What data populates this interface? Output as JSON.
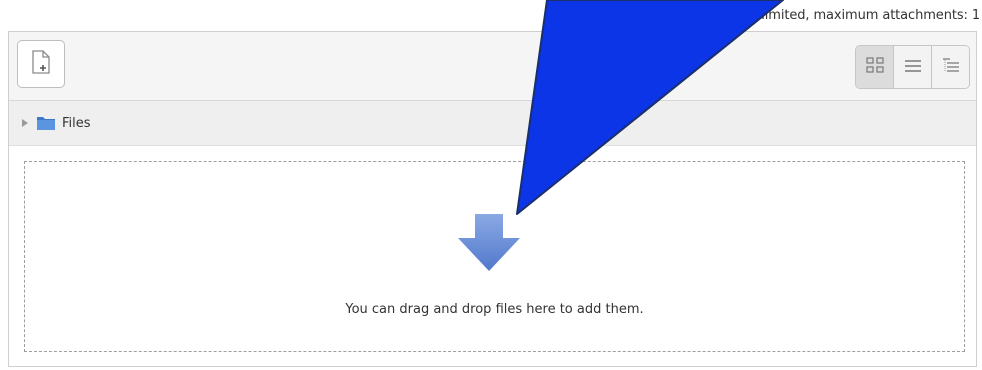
{
  "upload_limits": "Maximum size for new files: Unlimited, maximum attachments: 1",
  "breadcrumb": {
    "folder_label": "Files"
  },
  "dropzone": {
    "message": "You can drag and drop files here to add them."
  },
  "icons": {
    "add": "add-file-icon",
    "view_icons": "grid-view-icon",
    "view_list": "list-view-icon",
    "view_tree": "tree-view-icon",
    "expand": "triangle-right-icon",
    "folder": "folder-icon",
    "drop": "down-arrow-icon"
  },
  "colors": {
    "callout_fill": "#0b35e6",
    "callout_stroke": "#1b2f6b",
    "drop_arrow": "#6688d4"
  }
}
